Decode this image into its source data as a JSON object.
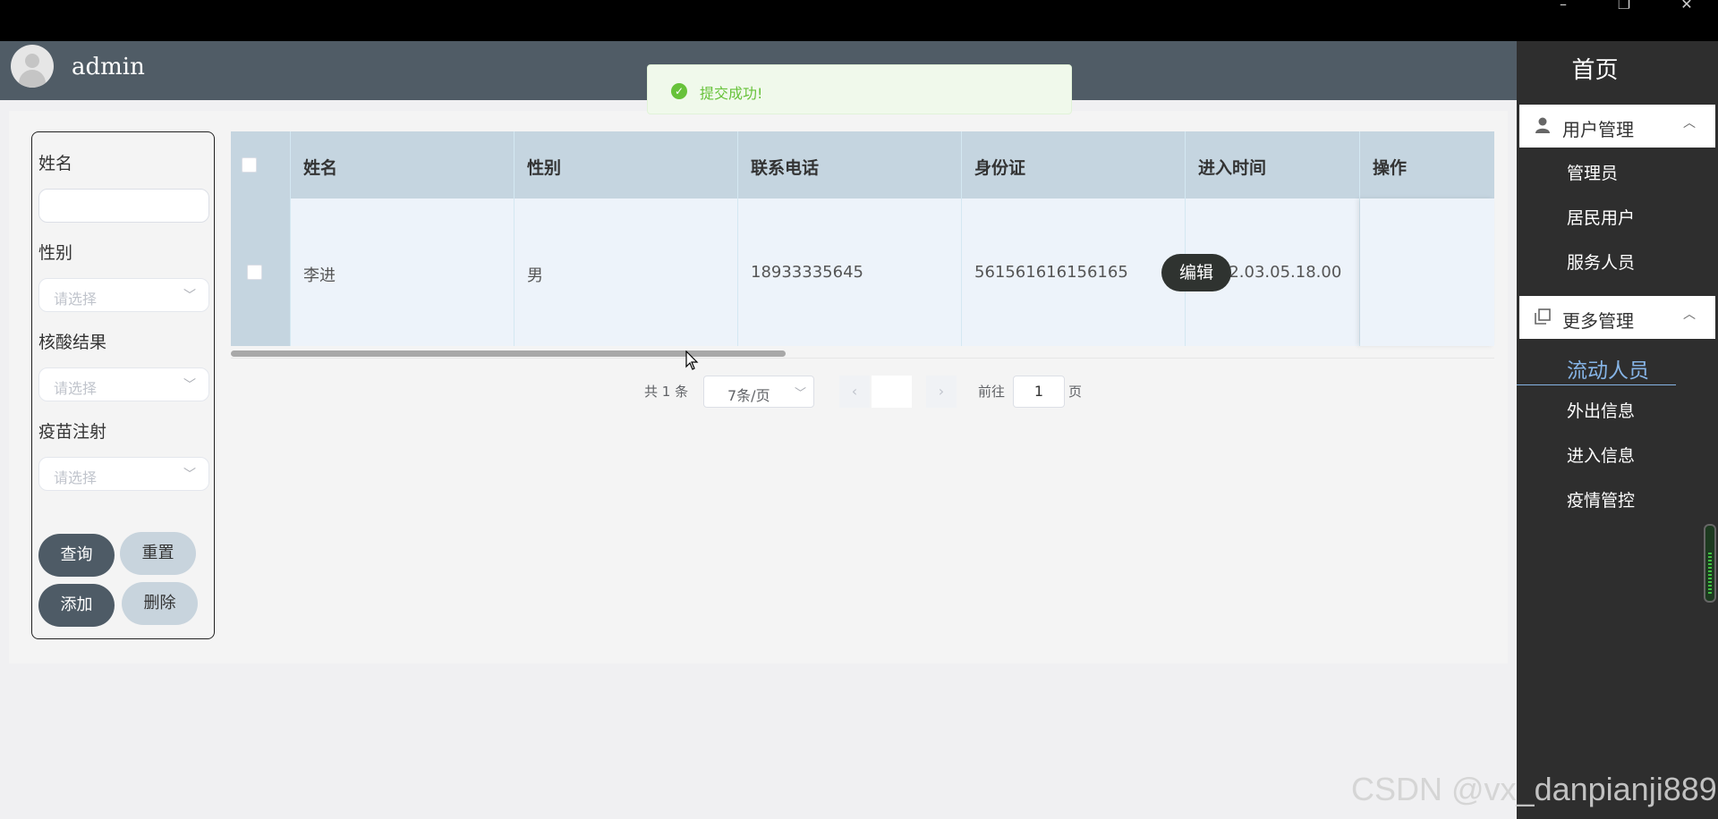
{
  "user": {
    "name": "admin"
  },
  "toast": {
    "message": "提交成功!"
  },
  "filters": {
    "name_label": "姓名",
    "name_value": "",
    "gender_label": "性别",
    "gender_placeholder": "请选择",
    "nucleic_label": "核酸结果",
    "nucleic_placeholder": "请选择",
    "vaccine_label": "疫苗注射",
    "vaccine_placeholder": "请选择",
    "buttons": {
      "query": "查询",
      "reset": "重置",
      "add": "添加",
      "delete": "删除"
    }
  },
  "table": {
    "columns": [
      "姓名",
      "性别",
      "联系电话",
      "身份证",
      "进入时间",
      "操作"
    ],
    "rows": [
      {
        "name": "李进",
        "gender": "男",
        "phone": "18933335645",
        "id_card": "561561616156165",
        "entry_time": "2022.03.05.18.00",
        "action": "编辑"
      }
    ]
  },
  "pagination": {
    "total": "共 1 条",
    "page_size": "7条/页",
    "goto_label": "前往",
    "goto_value": "1",
    "page_unit": "页"
  },
  "sidebar": {
    "title": "首页",
    "groups": [
      {
        "label": "用户管理",
        "icon": "user-icon",
        "items": [
          "管理员",
          "居民用户",
          "服务人员"
        ]
      },
      {
        "label": "更多管理",
        "icon": "copy-icon",
        "items": [
          "流动人员",
          "外出信息",
          "进入信息",
          "疫情管控"
        ]
      }
    ],
    "active_item": "流动人员"
  },
  "watermark": "CSDN @vx_danpianji889",
  "colors": {
    "header": "#505c66",
    "sidebar": "#2e2e2e",
    "active": "#86b4e6",
    "success": "#67c23a"
  }
}
